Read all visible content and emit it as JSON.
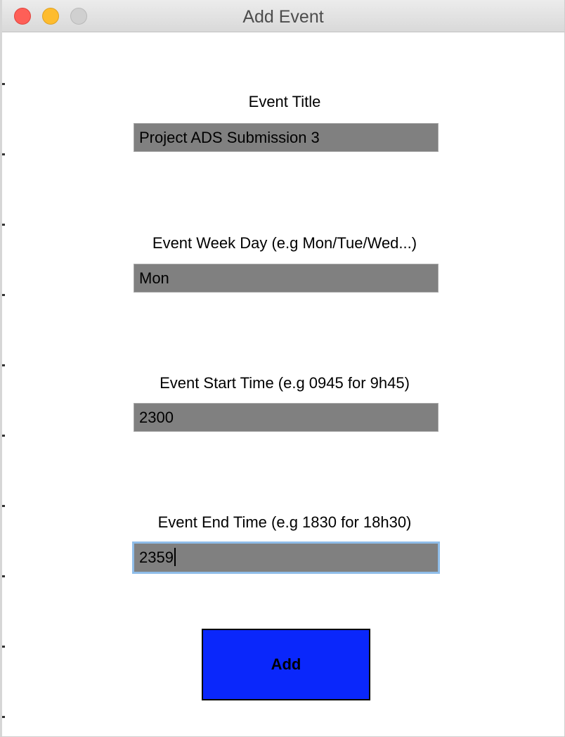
{
  "window": {
    "title": "Add Event"
  },
  "form": {
    "title_label": "Event Title",
    "title_value": "Project ADS Submission 3",
    "weekday_label": "Event Week Day (e.g Mon/Tue/Wed...)",
    "weekday_value": "Mon",
    "start_label": "Event Start Time (e.g 0945 for 9h45)",
    "start_value": "2300",
    "end_label": "Event End Time (e.g 1830 for 18h30)",
    "end_value": "2359",
    "add_label": "Add"
  },
  "colors": {
    "field_background": "#808080",
    "add_button": "#0a27fb",
    "focus_ring": "#8fbde9"
  }
}
